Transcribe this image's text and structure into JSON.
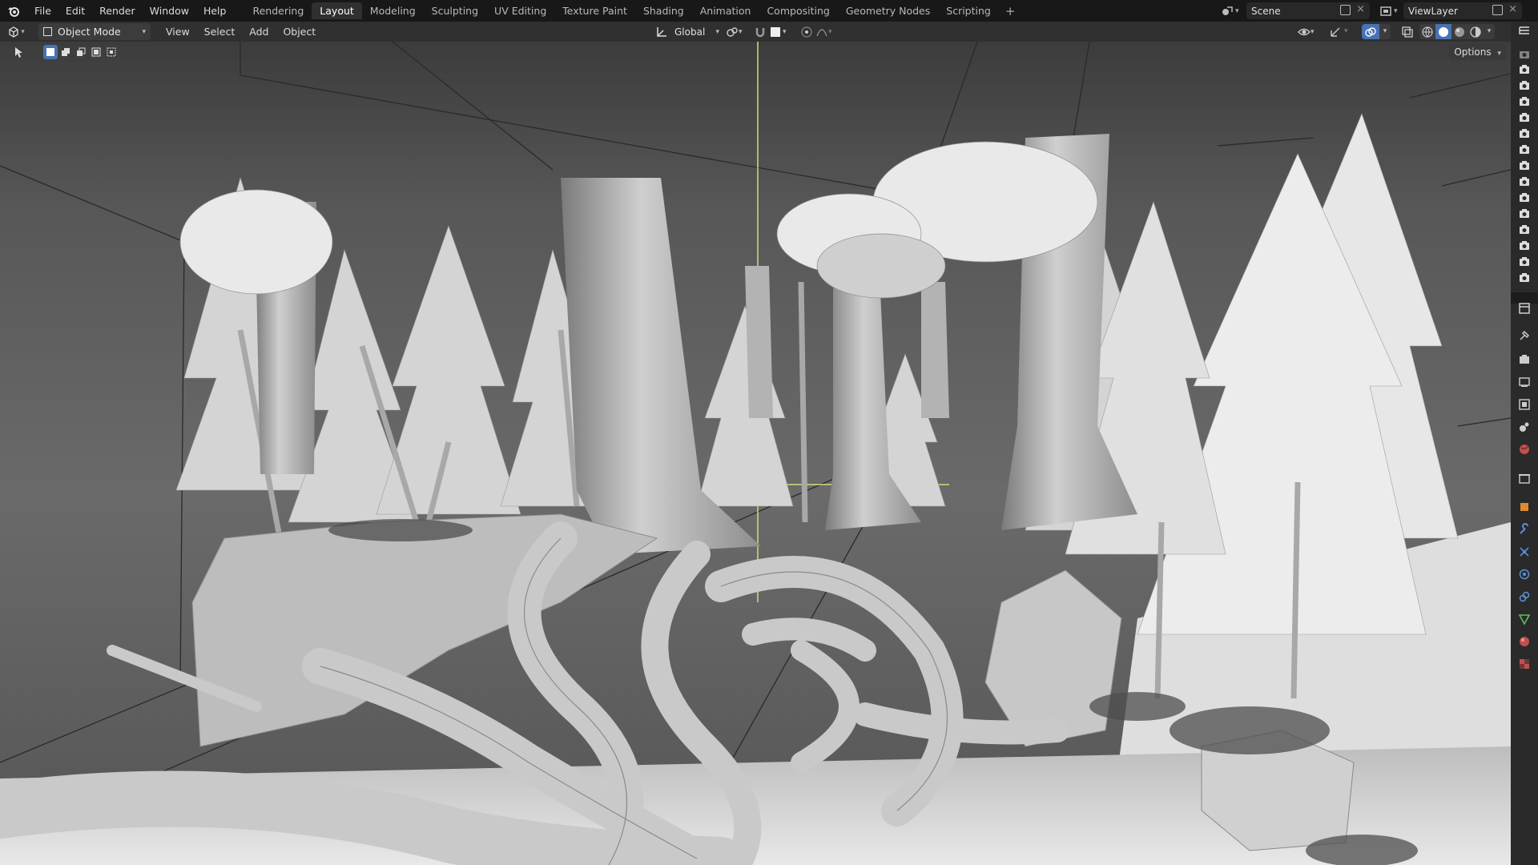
{
  "topbar": {
    "menus": [
      "File",
      "Edit",
      "Render",
      "Window",
      "Help"
    ],
    "tabs": [
      "Rendering",
      "Layout",
      "Modeling",
      "Sculpting",
      "UV Editing",
      "Texture Paint",
      "Shading",
      "Animation",
      "Compositing",
      "Geometry Nodes",
      "Scripting"
    ],
    "active_tab": "Layout",
    "scene": "Scene",
    "view_layer": "ViewLayer"
  },
  "header": {
    "mode": "Object Mode",
    "menus": [
      "View",
      "Select",
      "Add",
      "Object"
    ],
    "transform_orientation": "Global",
    "options_label": "Options"
  },
  "icons": {
    "logo": "blender-logo-icon",
    "editor_type": "3d-viewport-icon",
    "right_column": [
      "camera-icon",
      "camera-icon",
      "camera-icon",
      "camera-icon",
      "camera-icon",
      "camera-icon",
      "camera-icon",
      "camera-icon",
      "camera-icon",
      "camera-icon",
      "camera-icon",
      "camera-icon",
      "camera-icon",
      "camera-icon"
    ]
  },
  "colors": {
    "accent_blue": "#4772b3",
    "header_bg": "#303030",
    "topbar_bg": "#181818",
    "axis_yellow": "#d8d87a"
  }
}
